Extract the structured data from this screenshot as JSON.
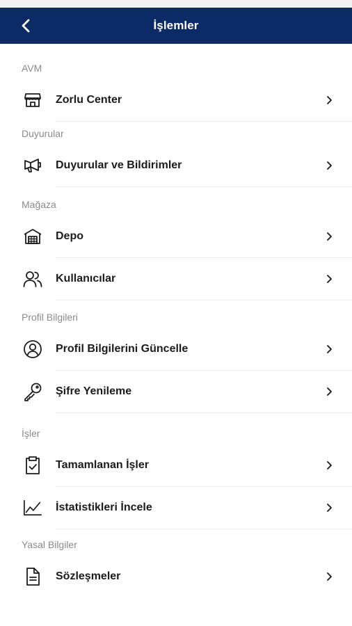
{
  "header": {
    "title": "İşlemler",
    "bg_color": "#0c2a66"
  },
  "sections": [
    {
      "title": "AVM",
      "items": [
        {
          "label": "Zorlu Center",
          "icon": "storefront-icon"
        }
      ]
    },
    {
      "title": "Duyurular",
      "items": [
        {
          "label": "Duyurular ve Bildirimler",
          "icon": "megaphone-icon"
        }
      ]
    },
    {
      "title": "Mağaza",
      "items": [
        {
          "label": "Depo",
          "icon": "warehouse-icon"
        },
        {
          "label": "Kullanıcılar",
          "icon": "users-icon"
        }
      ]
    },
    {
      "title": "Profil Bilgileri",
      "items": [
        {
          "label": "Profil Bilgilerini Güncelle",
          "icon": "user-circle-icon"
        },
        {
          "label": "Şifre Yenileme",
          "icon": "key-icon"
        }
      ]
    },
    {
      "title": "İşler",
      "items": [
        {
          "label": "Tamamlanan İşler",
          "icon": "clipboard-check-icon"
        },
        {
          "label": "İstatistikleri İncele",
          "icon": "chart-line-icon"
        }
      ]
    },
    {
      "title": "Yasal Bilgiler",
      "items": [
        {
          "label": "Sözleşmeler",
          "icon": "document-icon"
        }
      ]
    }
  ]
}
